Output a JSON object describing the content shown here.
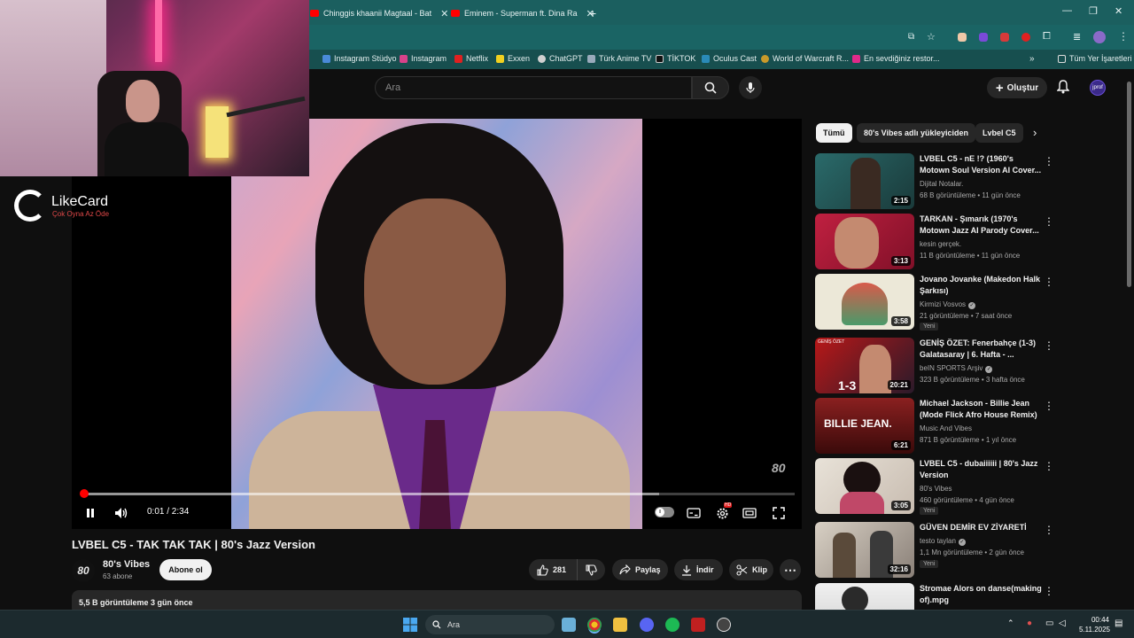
{
  "browser": {
    "tabs": [
      {
        "title": "Chinggis khaanii Magtaal - Bat"
      },
      {
        "title": "Eminem - Superman ft. Dina Ra"
      }
    ],
    "bookmarks": [
      {
        "label": "Instagram Stüdyo"
      },
      {
        "label": "Instagram"
      },
      {
        "label": "Netflix"
      },
      {
        "label": "Exxen"
      },
      {
        "label": "ChatGPT"
      },
      {
        "label": "Türk Anime TV"
      },
      {
        "label": "TİKTOK"
      },
      {
        "label": "Oculus Cast"
      },
      {
        "label": "World of Warcraft R..."
      },
      {
        "label": "En sevdiğiniz restor..."
      }
    ],
    "all_bookmarks_label": "Tüm Yer İşaretleri"
  },
  "overlay": {
    "logo_name": "LikeCard",
    "logo_tagline": "Çok Oyna  Az Öde"
  },
  "header": {
    "search_placeholder": "Ara",
    "create_label": "Oluştur",
    "avatar_text": "jprof"
  },
  "player": {
    "current_time": "0:01",
    "duration": "2:34",
    "time_display": "0:01 / 2:34",
    "watermark": "80",
    "progress": 0.003,
    "buffered": 0.81,
    "settings_badge": "HD"
  },
  "video": {
    "title": "LVBEL C5 - TAK TAK TAK | 80's Jazz Version",
    "channel_avatar_text": "80",
    "channel_name": "80's Vibes",
    "subscribers": "63 abone",
    "subscribe_label": "Abone ol",
    "likes": "281",
    "share_label": "Paylaş",
    "download_label": "İndir",
    "clip_label": "Klip",
    "stats": "5,5 B görüntüleme  3 gün önce"
  },
  "sidebar": {
    "chips": [
      {
        "label": "Tümü"
      },
      {
        "label": "80's Vibes adlı yükleyiciden"
      },
      {
        "label": "Lvbel C5"
      }
    ],
    "recommendations": [
      {
        "title": "LVBEL C5 - nE !? (1960's Motown Soul Version AI Cover...",
        "channel": "Dijital Notalar.",
        "meta": "68 B görüntüleme • 11 gün önce",
        "duration": "2:15",
        "badge": ""
      },
      {
        "title": "TARKAN - Şımarık (1970's Motown Jazz AI Parody Cover...",
        "channel": "kesin gerçek.",
        "meta": "11 B görüntüleme • 11 gün önce",
        "duration": "3:13",
        "badge": ""
      },
      {
        "title": "Jovano Jovanke (Makedon Halk Şarkısı)",
        "channel": "Kirmizi Vosvos",
        "meta": "21 görüntüleme • 7 saat önce",
        "duration": "3:58",
        "badge": "Yeni"
      },
      {
        "title": "GENİŞ ÖZET: Fenerbahçe (1-3) Galatasaray | 6. Hafta - ...",
        "channel": "beIN SPORTS Arşiv",
        "meta": "323 B görüntüleme • 3 hafta önce",
        "duration": "20:21",
        "badge": ""
      },
      {
        "title": "Michael Jackson - Billie Jean (Mode Flick Afro House Remix)",
        "channel": "Music And Vibes",
        "meta": "871 B görüntüleme • 1 yıl önce",
        "duration": "6:21",
        "badge": ""
      },
      {
        "title": "LVBEL C5 - dubaiiiiii | 80's Jazz Version",
        "channel": "80's Vibes",
        "meta": "460 görüntüleme • 4 gün önce",
        "duration": "3:05",
        "badge": "Yeni"
      },
      {
        "title": "GÜVEN DEMİR EV ZİYARETİ",
        "channel": "testo taylan",
        "meta": "1,1 Mn görüntüleme • 2 gün önce",
        "duration": "32:16",
        "badge": "Yeni"
      },
      {
        "title": "Stromae   Alors on danse(making of).mpg",
        "channel": "",
        "meta": "",
        "duration": "",
        "badge": ""
      }
    ],
    "thumb_texts": {
      "billie": "BILLIE JEAN.",
      "score": "1-3",
      "genis": "GENİŞ ÖZET"
    }
  },
  "taskbar": {
    "search_label": "Ara",
    "time": "00:44",
    "date": "5.11.2025"
  }
}
